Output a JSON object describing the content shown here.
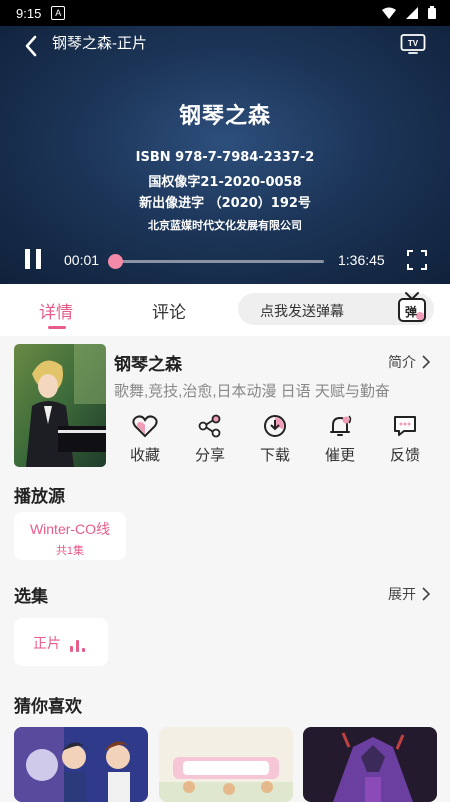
{
  "status_bar": {
    "time": "9:15",
    "notification_badge": "A",
    "icons": [
      "wifi-icon",
      "signal-icon",
      "battery-icon"
    ]
  },
  "player": {
    "title": "钢琴之森-正片",
    "slide": {
      "title": "钢琴之森",
      "isbn": "ISBN 978-7-7984-2337-2",
      "license_1": "国权像字21-2020-0058",
      "license_2": "新出像进字 （2020）192号",
      "publisher": "北京蓝媒时代文化发展有限公司"
    },
    "current_time": "00:01",
    "total_time": "1:36:45",
    "progress": 0.0
  },
  "tabs": [
    {
      "label": "详情",
      "active": true
    },
    {
      "label": "评论",
      "active": false
    }
  ],
  "danmaku": {
    "placeholder": "点我发送弹幕",
    "button_glyph": "弹"
  },
  "anime": {
    "title": "钢琴之森",
    "intro_label": "简介",
    "tags": "歌舞,竞技,治愈,日本动漫 日语 天赋与勤奋",
    "actions": [
      {
        "label": "收藏",
        "icon": "heart-icon"
      },
      {
        "label": "分享",
        "icon": "share-icon"
      },
      {
        "label": "下载",
        "icon": "download-icon"
      },
      {
        "label": "催更",
        "icon": "bell-icon"
      },
      {
        "label": "反馈",
        "icon": "feedback-icon"
      }
    ]
  },
  "play_source": {
    "section_title": "播放源",
    "sources": [
      {
        "name": "Winter-CO线",
        "count": "共1集"
      }
    ]
  },
  "episodes": {
    "section_title": "选集",
    "expand_label": "展开",
    "items": [
      {
        "name": "正片"
      }
    ]
  },
  "recommend": {
    "section_title": "猜你喜欢"
  },
  "colors": {
    "accent": "#e85c8a",
    "player_bg": "#1c3558",
    "page_bg": "#f6f6f6"
  }
}
